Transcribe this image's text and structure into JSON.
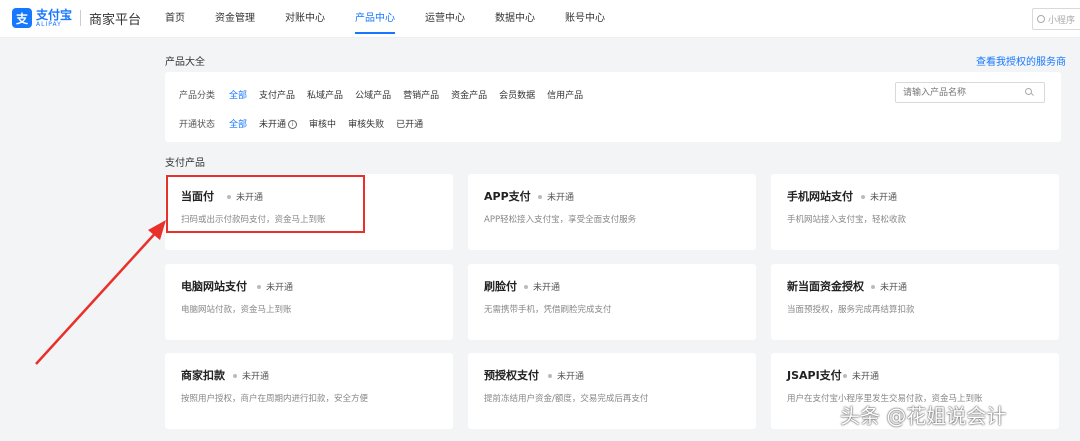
{
  "brand": {
    "logo_glyph": "支",
    "name_cn": "支付宝",
    "name_en": "ALIPAY",
    "platform": "商家平台"
  },
  "nav": {
    "items": [
      "首页",
      "资金管理",
      "对账中心",
      "产品中心",
      "运营中心",
      "数据中心",
      "账号中心"
    ],
    "active": "产品中心"
  },
  "top_search": {
    "placeholder": "小程序"
  },
  "page": {
    "title": "产品大全",
    "auth_link": "查看我授权的服务商",
    "section_title": "支付产品"
  },
  "filter": {
    "category_label": "产品分类",
    "categories": [
      "全部",
      "支付产品",
      "私域产品",
      "公域产品",
      "营销产品",
      "资金产品",
      "会员数据",
      "信用产品"
    ],
    "status_label": "开通状态",
    "statuses": [
      "全部",
      "未开通",
      "审核中",
      "审核失败",
      "已开通"
    ],
    "info_glyph": "i",
    "search_placeholder": "请输入产品名称"
  },
  "cards": [
    {
      "title": "当面付",
      "status": "未开通",
      "desc": "扫码或出示付款码支付，资金马上到账"
    },
    {
      "title": "APP支付",
      "status": "未开通",
      "desc": "APP轻松接入支付宝，享受全面支付服务"
    },
    {
      "title": "手机网站支付",
      "status": "未开通",
      "desc": "手机网站接入支付宝，轻松收款"
    },
    {
      "title": "电脑网站支付",
      "status": "未开通",
      "desc": "电脑网站付款，资金马上到账"
    },
    {
      "title": "刷脸付",
      "status": "未开通",
      "desc": "无需携带手机，凭借刷脸完成支付"
    },
    {
      "title": "新当面资金授权",
      "status": "未开通",
      "desc": "当面预授权，服务完成再结算扣款"
    },
    {
      "title": "商家扣款",
      "status": "未开通",
      "desc": "按照用户授权，商户在周期内进行扣款，安全方便"
    },
    {
      "title": "预授权支付",
      "status": "未开通",
      "desc": "提前冻结用户资金/额度，交易完成后再支付"
    },
    {
      "title": "JSAPI支付",
      "status": "未开通",
      "desc": "用户在支付宝小程序里发生交易付款，资金马上到账"
    }
  ],
  "watermark": "头条 @花姐说会计"
}
